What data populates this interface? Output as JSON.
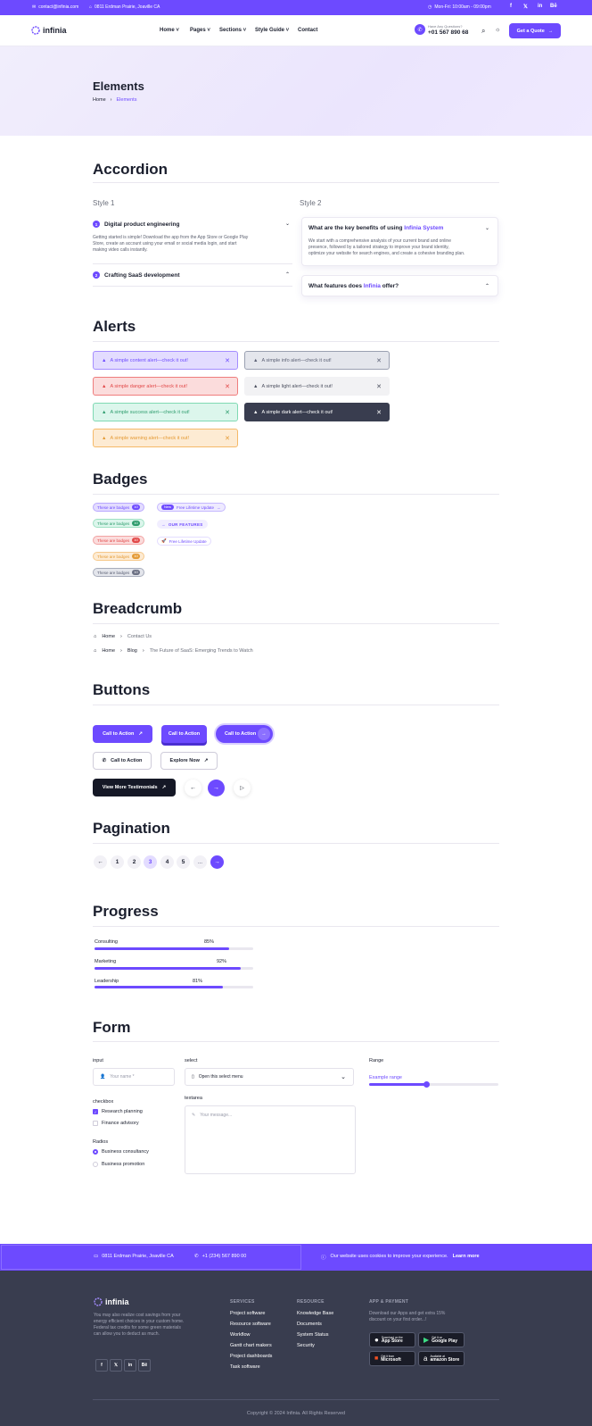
{
  "topbar": {
    "email": "contact@infinia.com",
    "address": "0811 Erdman Prairie, Joaville CA",
    "hours": "Mon-Fri: 10:00am - 09:00pm",
    "socials": [
      "f",
      "𝕏",
      "in",
      "Bē"
    ]
  },
  "header": {
    "logo": "infinia",
    "nav": [
      "Home",
      "Pages",
      "Sections",
      "Style Guide",
      "Contact"
    ],
    "help_label": "Have Any Questions?",
    "phone": "+01 567 890 68",
    "cta": "Get a Quote"
  },
  "hero": {
    "title": "Elements",
    "breadcrumb_home": "Home",
    "breadcrumb_current": "Elements"
  },
  "accordion": {
    "title": "Accordion",
    "style1_label": "Style 1",
    "style2_label": "Style 2",
    "s1_item1_num": "1",
    "s1_item1_title": "Digital product engineering",
    "s1_item1_body": [
      "Getting started is simple! Download the app from the App Store or Google Play",
      "Store, create an account using your email or social media login, and start",
      "making video calls instantly."
    ],
    "s1_item2_num": "2",
    "s1_item2_title": "Crafting SaaS development",
    "s2_item1_title": "What are the key benefits of using ",
    "s2_item1_brand": "Infinia System",
    "s2_item1_body": [
      "We start with a comprehensive analysis of your current brand and online",
      "presence, followed by a tailored strategy to improve your brand identity,",
      "optimize your website for search engines, and create a cohesive branding plan."
    ],
    "s2_item2_title_a": "What features does ",
    "s2_item2_brand": "Infinia",
    "s2_item2_title_b": " offer?"
  },
  "alerts": {
    "title": "Alerts",
    "items": [
      "A simple content alert—check it out!",
      "A simple info alert—check it out!",
      "A simple danger alert—check it out!",
      "A simple light alert—check it out!",
      "A simple success alert—check it out!",
      "A simple dark alert—check it out!",
      "A simple warning alert—check it out!"
    ]
  },
  "badges": {
    "title": "Badges",
    "pill_text": "These are badges",
    "pill_count": "10",
    "new_label": "New",
    "update_text": "Free Lifetime Update",
    "features_text": "OUR FEATURES",
    "rocket_text": "Free Lifetime Update"
  },
  "breadcrumb": {
    "title": "Breadcrumb",
    "row1": [
      "Home",
      "Contact Us"
    ],
    "row2": [
      "Home",
      "Blog",
      "The Future of SaaS: Emerging Trends to Watch"
    ]
  },
  "buttons": {
    "title": "Buttons",
    "cta1": "Call to Action",
    "cta2": "Call to Action",
    "cta3": "Call to Action",
    "call": "Call to Action",
    "explore": "Explore Now",
    "testimonials": "View More Testimonials"
  },
  "pagination": {
    "title": "Pagination",
    "pages": [
      "1",
      "2",
      "3",
      "4",
      "5",
      "..."
    ],
    "active": "3"
  },
  "progress": {
    "title": "Progress",
    "items": [
      {
        "label": "Consulting",
        "value_text": "85%",
        "value": 0.85
      },
      {
        "label": "Marketing",
        "value_text": "92%",
        "value": 0.92
      },
      {
        "label": "Leadership",
        "value_text": "81%",
        "value": 0.81
      }
    ]
  },
  "form": {
    "title": "Form",
    "input_label": "input",
    "input_placeholder": "Your name *",
    "select_label": "select",
    "select_value": "Open this select menu",
    "range_label": "Range",
    "range_caption": "Example range",
    "range_value": 0.44,
    "checkbox_label": "checkbox",
    "check1": "Research planning",
    "check2": "Finance advisory",
    "textarea_label": "textarea",
    "textarea_placeholder": "Your message...",
    "radio_label": "Radios",
    "radio1": "Business consultancy",
    "radio2": "Business promotion"
  },
  "cookie": {
    "address": "0811 Erdman Prairie, Joaville CA",
    "phone": "+1 (234) 567 890 00",
    "notice": "Our website uses cookies to improve your experience.",
    "learn": "Learn more"
  },
  "footer": {
    "logo": "infinia",
    "about": [
      "You may also realize cost savings from your",
      "energy efficient choices in your custom home.",
      "Federal tax credits for some green materials",
      "can allow you to deduct as much."
    ],
    "services_head": "SERVICES",
    "services": [
      "Project software",
      "Resource software",
      "Workflow",
      "Gantt chart makers",
      "Project dashboards",
      "Task software"
    ],
    "resource_head": "RESOURCE",
    "resource": [
      "Knowledge Base",
      "Documents",
      "System Status",
      "Security"
    ],
    "app_head": "APP & PAYMENT",
    "app_text": [
      "Download our Apps and get extra 15%",
      "discount on your first order...!"
    ],
    "stores": [
      {
        "small": "Download on the",
        "big": "App Store"
      },
      {
        "small": "Get it on",
        "big": "Google Play"
      },
      {
        "small": "Get it from",
        "big": "Microsoft"
      },
      {
        "small": "Available at",
        "big": "amazon Store"
      }
    ],
    "socials": [
      "f",
      "𝕏",
      "in",
      "Bē"
    ],
    "copyright": "Copyright © 2024 Infinia. All Rights Reserved"
  }
}
